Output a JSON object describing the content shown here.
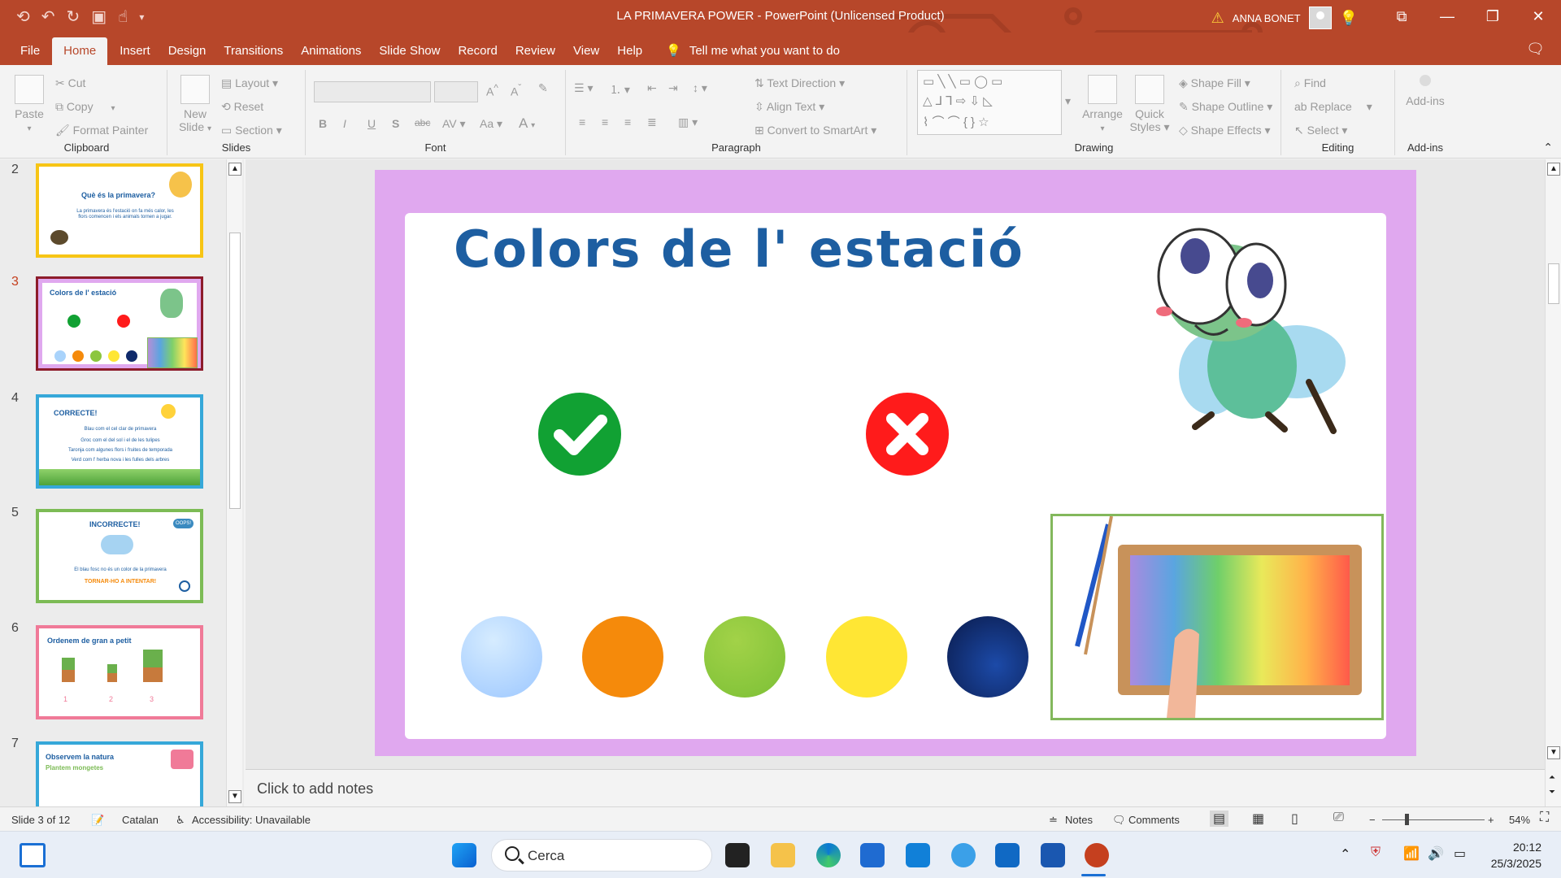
{
  "app": {
    "title": "LA PRIMAVERA POWER  -  PowerPoint (Unlicensed Product)",
    "user": "ANNA BONET",
    "accent": "#b7472a"
  },
  "tabs": [
    "File",
    "Home",
    "Insert",
    "Design",
    "Transitions",
    "Animations",
    "Slide Show",
    "Record",
    "Review",
    "View",
    "Help"
  ],
  "tell_me": "Tell me what you want to do",
  "ribbon": {
    "clipboard": {
      "paste": "Paste",
      "cut": "Cut",
      "copy": "Copy",
      "format_painter": "Format Painter",
      "label": "Clipboard"
    },
    "slides": {
      "new_slide_1": "New",
      "new_slide_2": "Slide",
      "layout": "Layout",
      "reset": "Reset",
      "section": "Section",
      "label": "Slides"
    },
    "font": {
      "label": "Font",
      "bold": "B",
      "italic": "I",
      "underline": "U",
      "shadow": "S",
      "strike": "abc",
      "spacing": "AV",
      "case": "Aa",
      "color": "A"
    },
    "paragraph": {
      "text_direction": "Text Direction",
      "align_text": "Align Text",
      "convert_smartart": "Convert to SmartArt",
      "label": "Paragraph"
    },
    "drawing": {
      "arrange": "Arrange",
      "quick_styles_1": "Quick",
      "quick_styles_2": "Styles",
      "shape_fill": "Shape Fill",
      "shape_outline": "Shape Outline",
      "shape_effects": "Shape Effects",
      "label": "Drawing"
    },
    "editing": {
      "find": "Find",
      "replace": "Replace",
      "select": "Select",
      "label": "Editing"
    },
    "addins": {
      "button": "Add-ins",
      "label": "Add-ins"
    }
  },
  "thumbnails": [
    {
      "num": "2",
      "title": "Què és la primavera?",
      "text": "La primavera és l'estació on fa més calor, les flors comencen i els animals tornen a jugar."
    },
    {
      "num": "3",
      "title": "Colors de l' estació"
    },
    {
      "num": "4",
      "title": "CORRECTE!",
      "lines": [
        "Blau com el cel clar de primavera",
        "Groc com el del sol i el de les tulipes",
        "Taronja com algunes flors i fruites de temporada",
        "Verd com l' herba nova i les fulles dels arbres"
      ]
    },
    {
      "num": "5",
      "title": "INCORRECTE!",
      "text": "El blau fosc no és un color de la primavera",
      "cta": "TORNAR-HO A INTENTAR!",
      "badge": "OOPS!"
    },
    {
      "num": "6",
      "title": "Ordenem de gran a petit",
      "nums": [
        "1",
        "2",
        "3"
      ]
    },
    {
      "num": "7",
      "title": "Observem la natura",
      "subtitle": "Plantem mongetes"
    }
  ],
  "slide": {
    "title": "Colors de l' estació",
    "colors": [
      "#a9d3fb",
      "#f58a0b",
      "#8cc63f",
      "#ffe634",
      "#0f2a6b"
    ],
    "border_color": "#e0a8ef"
  },
  "notes_placeholder": "Click to add notes",
  "status": {
    "slide_info": "Slide 3 of 12",
    "language": "Catalan",
    "accessibility": "Accessibility: Unavailable",
    "notes": "Notes",
    "comments": "Comments",
    "zoom": "54%"
  },
  "taskbar": {
    "search": "Cerca",
    "time": "20:12",
    "date": "25/3/2025"
  }
}
